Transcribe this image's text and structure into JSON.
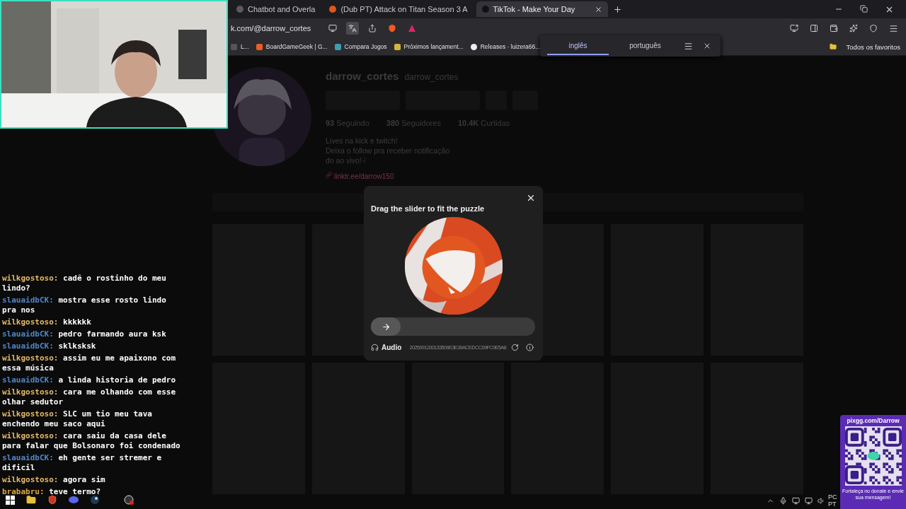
{
  "browser": {
    "tabs": [
      {
        "title": "Chatbot and Overla",
        "selected": false
      },
      {
        "title": "(Dub PT) Attack on Titan Season 3 A",
        "selected": false
      },
      {
        "title": "TikTok - Make Your Day",
        "selected": true
      }
    ],
    "address": "k.com/@darrow_cortes",
    "bookmarks": [
      "L...",
      "BoardGameGeek | G...",
      "Compara Jogos",
      "Próximos lançament...",
      "Releases · luizera66..."
    ],
    "all_bookmarks": "Todos os favoritos",
    "translate": [
      {
        "label": "inglês",
        "selected": true
      },
      {
        "label": "português",
        "selected": false
      }
    ]
  },
  "profile": {
    "name": "darrow_cortes",
    "handle": "darrow_cortes",
    "stats": [
      {
        "value": "93",
        "label": "Seguindo"
      },
      {
        "value": "380",
        "label": "Seguidores"
      },
      {
        "value": "10.4K",
        "label": "Curtidas"
      }
    ],
    "bio": [
      "Lives na kick e twitch!",
      "Deixa o follow pra receber notificação",
      "do ao vivo!☟"
    ],
    "link": "linktr.ee/darrow150"
  },
  "captcha": {
    "title": "Drag the slider to fit the puzzle",
    "level": 0,
    "audio": "Audio",
    "code": "2025091200133509E3E39ACEDCC09FC9E5A8"
  },
  "chat": [
    {
      "user": "wilkgostoso:",
      "color": "#e3b866",
      "text": "cadê o rostinho do meu lindo?"
    },
    {
      "user": "slauaidbCK:",
      "color": "#4f86c6",
      "text": "mostra esse rosto lindo pra nos"
    },
    {
      "user": "wilkgostoso:",
      "color": "#e3b866",
      "text": "kkkkkk"
    },
    {
      "user": "slauaidbCK:",
      "color": "#4f86c6",
      "text": "pedro farmando aura ksk"
    },
    {
      "user": "slauaidbCK:",
      "color": "#4f86c6",
      "text": "sklksksk"
    },
    {
      "user": "wilkgostoso:",
      "color": "#e3b866",
      "text": "assim eu me apaixono com essa música"
    },
    {
      "user": "slauaidbCK:",
      "color": "#4f86c6",
      "text": "a linda historia de pedro"
    },
    {
      "user": "wilkgostoso:",
      "color": "#e3b866",
      "text": "cara me olhando com esse olhar sedutor"
    },
    {
      "user": "wilkgostoso:",
      "color": "#e3b866",
      "text": "SLC um tio meu tava enchendo meu saco aqui"
    },
    {
      "user": "wilkgostoso:",
      "color": "#e3b866",
      "text": "cara saiu da casa dele para falar que Bolsonaro foi condenado"
    },
    {
      "user": "slauaidbCK:",
      "color": "#4f86c6",
      "text": "eh gente ser stremer e dificil"
    },
    {
      "user": "wilkgostoso:",
      "color": "#e3b866",
      "text": "agora sim"
    },
    {
      "user": "brababru:",
      "color": "#d9a640",
      "text": "teve termo?"
    }
  ],
  "donation": {
    "url": "pixgg.com/Darrow",
    "message": "Fortaleça no donate e envie sua mensagem!"
  },
  "tray": [
    "PC",
    "PT"
  ]
}
